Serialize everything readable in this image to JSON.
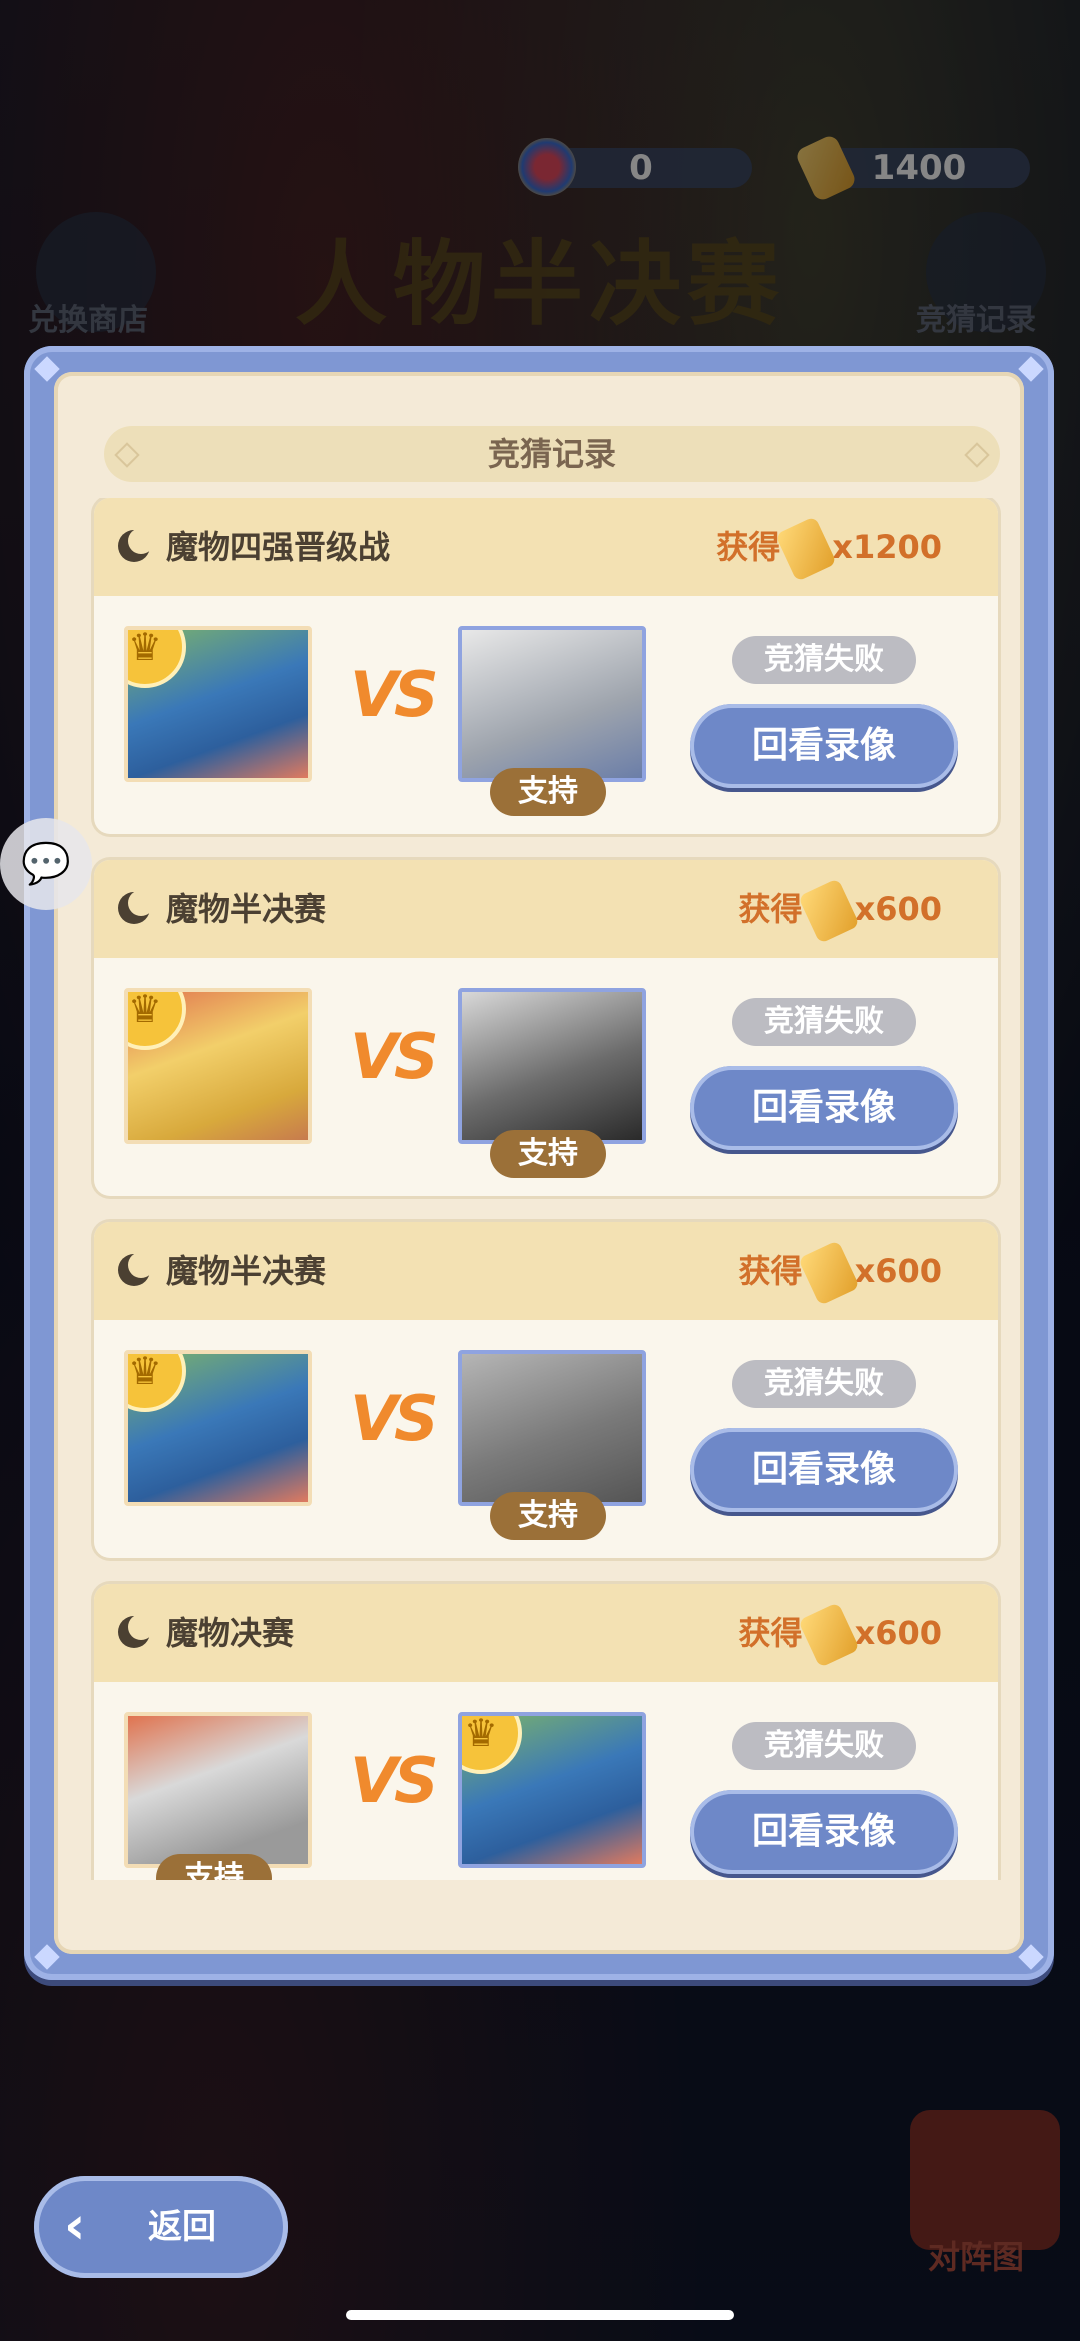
{
  "header": {
    "title": "人物半决赛",
    "gem_count": "0",
    "ticket_count": "1400",
    "left_button_label": "兑换商店",
    "right_button_label": "竞猜记录"
  },
  "panel": {
    "title": "竞猜记录"
  },
  "records": [
    {
      "name": "魔物四强晋级战",
      "reward_prefix": "获得",
      "reward_amount": "x1200",
      "vs": "VS",
      "support": "支持",
      "result": "竞猜失败",
      "replay": "回看录像"
    },
    {
      "name": "魔物半决赛",
      "reward_prefix": "获得",
      "reward_amount": "x600",
      "vs": "VS",
      "support": "支持",
      "result": "竞猜失败",
      "replay": "回看录像"
    },
    {
      "name": "魔物半决赛",
      "reward_prefix": "获得",
      "reward_amount": "x600",
      "vs": "VS",
      "support": "支持",
      "result": "竞猜失败",
      "replay": "回看录像"
    },
    {
      "name": "魔物决赛",
      "reward_prefix": "获得",
      "reward_amount": "x600",
      "vs": "VS",
      "support": "支持",
      "result": "竞猜失败",
      "replay": "回看录像"
    }
  ],
  "footer": {
    "back_label": "返回",
    "map_label": "对阵图"
  }
}
